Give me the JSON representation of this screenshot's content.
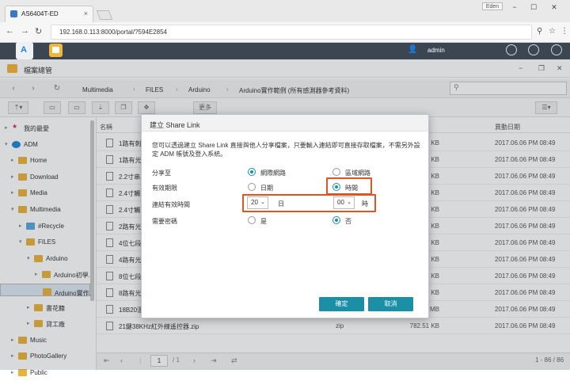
{
  "browser": {
    "tab_title": "AS6404T-ED",
    "tab_close": "×",
    "profile": "Eden",
    "url": "192.168.0.113:8000/portal/?594E2854",
    "win_min": "−",
    "win_max": "☐",
    "win_close": "✕"
  },
  "adm": {
    "username": "admin",
    "logo": "A"
  },
  "window": {
    "title": "檔案總管",
    "min": "−",
    "restore": "❐",
    "close": "✕"
  },
  "breadcrumb": [
    "Multimedia",
    "FILES",
    "Arduino",
    "Arduino實作範例 (所有感測器參考資料)"
  ],
  "toolbar": {
    "view_more": "更多"
  },
  "sidebar": [
    {
      "label": "我的最愛",
      "caret": "▸",
      "depth": 0,
      "icon": "star"
    },
    {
      "label": "ADM",
      "caret": "▾",
      "depth": 0,
      "icon": "adm"
    },
    {
      "label": "Home",
      "caret": "▸",
      "depth": 1,
      "icon": "folder"
    },
    {
      "label": "Download",
      "caret": "▸",
      "depth": 1,
      "icon": "folder"
    },
    {
      "label": "Media",
      "caret": "▸",
      "depth": 1,
      "icon": "folder"
    },
    {
      "label": "Multimedia",
      "caret": "▾",
      "depth": 1,
      "icon": "folder"
    },
    {
      "label": "#Recycle",
      "caret": "▸",
      "depth": 2,
      "icon": "recycle"
    },
    {
      "label": "FILES",
      "caret": "▾",
      "depth": 2,
      "icon": "folder"
    },
    {
      "label": "Arduino",
      "caret": "▾",
      "depth": 3,
      "icon": "folder"
    },
    {
      "label": "Arduino初學...",
      "caret": "▸",
      "depth": 4,
      "icon": "folder"
    },
    {
      "label": "Arduino實作...",
      "caret": "",
      "depth": 4,
      "icon": "folder",
      "selected": true
    },
    {
      "label": "書花籍",
      "caret": "▸",
      "depth": 3,
      "icon": "folder"
    },
    {
      "label": "貸工廠",
      "caret": "▸",
      "depth": 3,
      "icon": "folder"
    },
    {
      "label": "Music",
      "caret": "▸",
      "depth": 1,
      "icon": "folder"
    },
    {
      "label": "PhotoGallery",
      "caret": "▸",
      "depth": 1,
      "icon": "folder"
    },
    {
      "label": "Public",
      "caret": "▸",
      "depth": 1,
      "icon": "folder"
    }
  ],
  "list": {
    "headers": {
      "name": "名稱",
      "modified": "異動日期"
    },
    "rows": [
      {
        "name": "1路有刺...",
        "type": "",
        "size": "5 KB",
        "date": "2017.06.06 PM 08:49"
      },
      {
        "name": "1路有光...",
        "type": "",
        "size": "5 KB",
        "date": "2017.06.06 PM 08:49"
      },
      {
        "name": "2.2寸串...",
        "type": "",
        "size": "6 KB",
        "date": "2017.06.06 PM 08:49"
      },
      {
        "name": "2.4寸觸...",
        "type": "",
        "size": "1 KB",
        "date": "2017.06.06 PM 08:49"
      },
      {
        "name": "2.4寸觸...",
        "type": "",
        "size": "3 KB",
        "date": "2017.06.06 PM 08:49"
      },
      {
        "name": "2路有光...",
        "type": "",
        "size": "5 KB",
        "date": "2017.06.06 PM 08:49"
      },
      {
        "name": "4位七段...",
        "type": "",
        "size": "5 KB",
        "date": "2017.06.06 PM 08:49"
      },
      {
        "name": "4路有光...",
        "type": "",
        "size": "5 KB",
        "date": "2017.06.06 PM 08:49"
      },
      {
        "name": "8位七段...",
        "type": "",
        "size": "5 KB",
        "date": "2017.06.06 PM 08:49"
      },
      {
        "name": "8路有光...",
        "type": "",
        "size": "5 KB",
        "date": "2017.06.06 PM 08:49"
      },
      {
        "name": "18B20溫度傳感器.rar",
        "type": "rar",
        "size": "2.25 MB",
        "date": "2017.06.06 PM 08:49"
      },
      {
        "name": "21鍵38KHz紅外線遙控器.zip",
        "type": "zip",
        "size": "782.51 KB",
        "date": "2017.06.06 PM 08:49"
      }
    ]
  },
  "pager": {
    "page": "1",
    "of": "/ 1",
    "count": "1 - 86 / 86"
  },
  "dialog": {
    "title": "建立 Share Link",
    "description": "您可以透過建立 Share Link 直接與他人分享檔案，只要輸入連結即可直接存取檔案，不需另外設定 ADM 帳號及登入系統。",
    "share_label": "分享至",
    "share_opt1": "網際網路",
    "share_opt2": "區域網路",
    "expire_label": "有效期限",
    "expire_opt1": "日期",
    "expire_opt2": "時間",
    "duration_label": "連結有效時間",
    "days_value": "20",
    "days_unit": "日",
    "hours_value": "00",
    "hours_unit": "時",
    "password_label": "需要密碼",
    "pw_opt1": "是",
    "pw_opt2": "否",
    "ok": "確定",
    "cancel": "取消"
  }
}
